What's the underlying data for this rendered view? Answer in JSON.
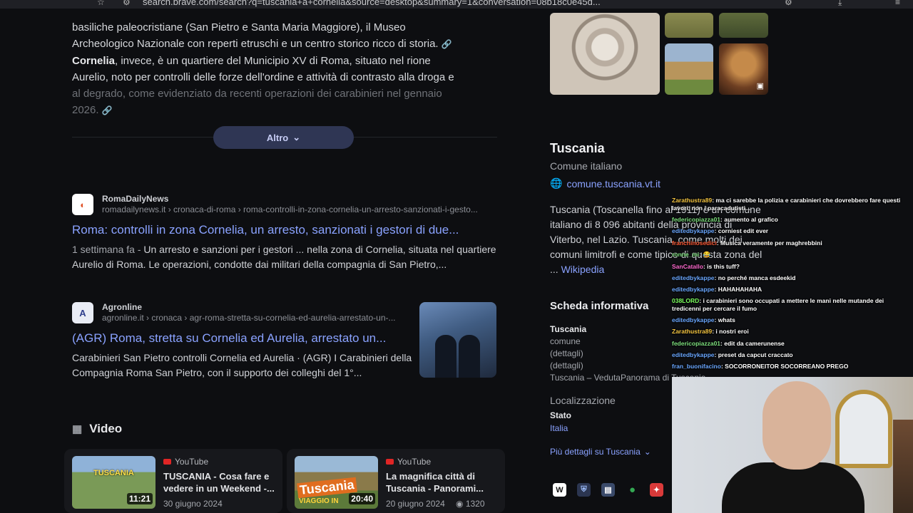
{
  "browser": {
    "url": "search.brave.com/search?q=tuscania+a+cornelia&source=desktop&summary=1&conversation=08b18c0e45d..."
  },
  "summary": {
    "line1": "basiliche paleocristiane (San Pietro e Santa Maria Maggiore), il Museo",
    "line2": "Archeologico Nazionale con reperti etruschi e un centro storico ricco di storia.",
    "cornelia_bold": "Cornelia",
    "line3": ", invece, è un quartiere del Municipio XV di Roma, situato nel rione",
    "line4": "Aurelio, noto per controlli delle forze dell'ordine e attività di contrasto alla droga e",
    "line5": "al degrado, come evidenziato da recenti operazioni dei carabinieri nel gennaio",
    "line6": "2026.",
    "more_button": "Altro"
  },
  "results": [
    {
      "source_name": "RomaDailyNews",
      "source_url": "romadailynews.it › cronaca-di-roma › roma-controlli-in-zona-cornelia-un-arresto-sanzionati-i-gesto...",
      "title": "Roma: controlli in zona Cornelia, un arresto, sanzionati i gestori di due...",
      "age": "1 settimana fa - ",
      "description": "Un arresto e sanzioni per i gestori ... nella zona di Cornelia, situata nel quartiere Aurelio di Roma. Le operazioni, condotte dai militari della compagnia di San Pietro,..."
    },
    {
      "source_name": "Agronline",
      "source_url": "agronline.it › cronaca › agr-roma-stretta-su-cornelia-ed-aurelia-arrestato-un-...",
      "title": "(AGR) Roma, stretta su Cornelia ed Aurelia, arrestato un...",
      "description": "Carabinieri San Pietro controlli Cornelia ed Aurelia · (AGR) I Carabinieri della Compagnia Roma San Pietro, con il supporto dei colleghi del 1°..."
    }
  ],
  "video_section": {
    "heading": "Video",
    "videos": [
      {
        "platform": "YouTube",
        "title": "TUSCANIA - Cosa fare e vedere in un Weekend -...",
        "date": "30 giugno 2024",
        "duration": "11:21",
        "thumb_text": "TUSCANIA"
      },
      {
        "platform": "YouTube",
        "title": "La magnifica città di Tuscania - Panorami...",
        "date": "20 giugno 2024",
        "views": "1320",
        "duration": "20:40",
        "thumb_text": "Tuscania",
        "thumb_sub": "VIAGGIO IN"
      }
    ]
  },
  "infobox": {
    "title": "Tuscania",
    "subtitle": "Comune italiano",
    "website": "comune.tuscania.vt.it",
    "desc_l1": "Tuscania (Toscanella fino al 1911) è un comune",
    "desc_l2": "italiano di 8 096 abitanti della provincia di",
    "desc_l3": "Viterbo, nel Lazio. Tuscania, come molti dei",
    "desc_l4": "comuni limitrofi e come tipico di questa zona del",
    "desc_l5_prefix": "... ",
    "wiki_link": "Wikipedia",
    "info_heading": "Scheda informativa",
    "kv_title": "Tuscania",
    "kv_lines": [
      "comune",
      "(dettagli)",
      "(dettagli)",
      "Tuscania – VedutaPanorama di Tuscania"
    ],
    "loc_heading": "Localizzazione",
    "stato_label": "Stato",
    "stato_value": "Italia",
    "more_details": "Più dettagli su Tuscania"
  },
  "chat": [
    {
      "user": "Zarathustra89",
      "color": "#f4c542",
      "text": ": ma ci sarebbe la polizia e carabinieri che dovrebbero fare questi lavori, non i paracadutisti...",
      "wrap": true
    },
    {
      "user": "federicopiazza01",
      "color": "#7ee07e",
      "text": ": aumento al grafico"
    },
    {
      "user": "editedbykappe",
      "color": "#6aa7ff",
      "text": ": corniest edit ever"
    },
    {
      "user": "franchinosedici",
      "color": "#ff5a36",
      "text": ": Musica veramente per maghrebbini"
    },
    {
      "user": "ronne_mi",
      "color": "#7ee07e",
      "text": ": 😂"
    },
    {
      "user": "SanCatallo",
      "color": "#ff6bd0",
      "text": ": is this tuff?"
    },
    {
      "user": "editedbykappe",
      "color": "#6aa7ff",
      "text": ": no perché manca esdeekid"
    },
    {
      "user": "editedbykappe",
      "color": "#6aa7ff",
      "text": ": HAHAHAHAHA"
    },
    {
      "user": "038LORD",
      "color": "#7cff5e",
      "text": ": i carabinieri sono occupati a mettere le mani nelle mutande dei tredicenni per cercare il fumo",
      "wrap": true
    },
    {
      "user": "editedbykappe",
      "color": "#6aa7ff",
      "text": ": whats"
    },
    {
      "user": "Zarathustra89",
      "color": "#f4c542",
      "text": ": i nostri eroi"
    },
    {
      "user": "federicopiazza01",
      "color": "#7ee07e",
      "text": ": edit da camerunense"
    },
    {
      "user": "editedbykappe",
      "color": "#6aa7ff",
      "text": ": preset da capcut craccato"
    },
    {
      "user": "fran_buonifacino",
      "color": "#6aa7ff",
      "text": ": SOCORRONEITOR SOCORREANO PREGO"
    }
  ]
}
